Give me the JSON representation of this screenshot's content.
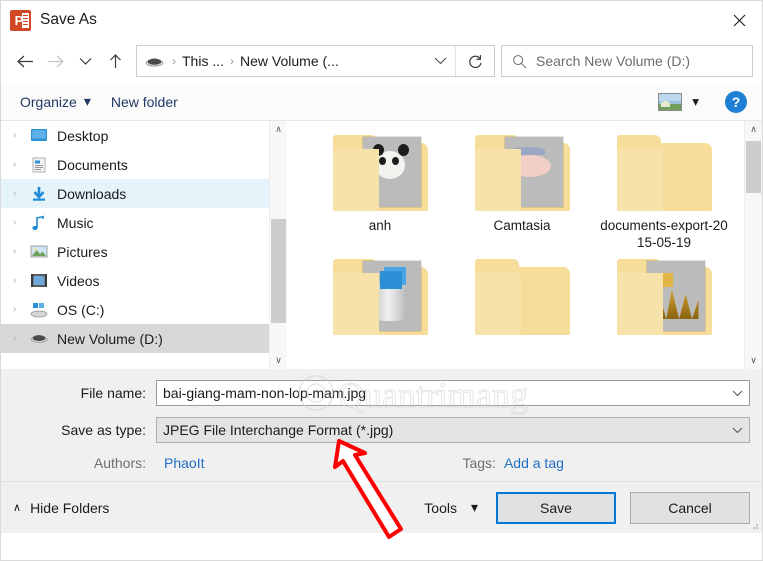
{
  "window": {
    "title": "Save As",
    "app_icon": "powerpoint-icon",
    "close_label": "✕",
    "accent": "#0078d7",
    "ppt_color": "#d24726",
    "ppt_letter": "P"
  },
  "nav": {
    "back_label": "←",
    "forward_label": "→",
    "recent_label": "∨",
    "up_label": "↑",
    "breadcrumb": [
      {
        "label": "This ...",
        "icon": "drive-icon"
      },
      {
        "label": "New Volume (...",
        "icon": ""
      }
    ],
    "separator": "›",
    "dropdown_label": "∨",
    "refresh_label": "↻"
  },
  "search": {
    "placeholder": "Search New Volume (D:)",
    "icon": "search-icon"
  },
  "toolbar": {
    "organize_label": "Organize",
    "organize_caret": "▾",
    "new_folder_label": "New folder",
    "view_icon": "picture-view-icon",
    "view_caret": "▾",
    "help_label": "?"
  },
  "sidebar": {
    "items": [
      {
        "label": "Desktop",
        "icon": "desktop-icon",
        "state": "normal"
      },
      {
        "label": "Documents",
        "icon": "documents-icon",
        "state": "normal"
      },
      {
        "label": "Downloads",
        "icon": "downloads-icon",
        "state": "hover"
      },
      {
        "label": "Music",
        "icon": "music-icon",
        "state": "normal"
      },
      {
        "label": "Pictures",
        "icon": "pictures-icon",
        "state": "normal"
      },
      {
        "label": "Videos",
        "icon": "videos-icon",
        "state": "normal"
      },
      {
        "label": "OS (C:)",
        "icon": "windows-drive-icon",
        "state": "normal"
      },
      {
        "label": "New Volume (D:)",
        "icon": "drive-icon",
        "state": "selected"
      }
    ],
    "expand_chevron": "›",
    "scroll_up": "∧",
    "scroll_down": "∨"
  },
  "files": {
    "items": [
      {
        "name": "anh",
        "thumb": "panda-photo-thumb"
      },
      {
        "name": "Camtasia",
        "thumb": "face-photo-thumb"
      },
      {
        "name": "documents-export-2015-05-19",
        "thumb": "none"
      },
      {
        "name": "",
        "thumb": "recycle-bin-thumb"
      },
      {
        "name": "",
        "thumb": "none"
      },
      {
        "name": "",
        "thumb": "gold-dark-thumb"
      }
    ],
    "scroll_up": "∧",
    "scroll_down": "∨"
  },
  "form": {
    "file_name_label": "File name:",
    "file_name_value": "bai-giang-mam-non-lop-mam.jpg",
    "file_name_chevron": "∨",
    "save_type_label": "Save as type:",
    "save_type_value": "JPEG File Interchange Format (*.jpg)",
    "save_type_chevron": "∨",
    "authors_label": "Authors:",
    "authors_value": "PhaoIt",
    "tags_label": "Tags:",
    "tags_value": "Add a tag"
  },
  "footer": {
    "hide_folders_label": "Hide Folders",
    "hide_folders_chevron": "∧",
    "tools_label": "Tools",
    "tools_caret": "▾",
    "save_label": "Save",
    "cancel_label": "Cancel"
  },
  "annotations": {
    "arrow_color": "#ff0000",
    "arrow_target": "save-as-type-field",
    "watermark_text": "Quantrimang"
  }
}
